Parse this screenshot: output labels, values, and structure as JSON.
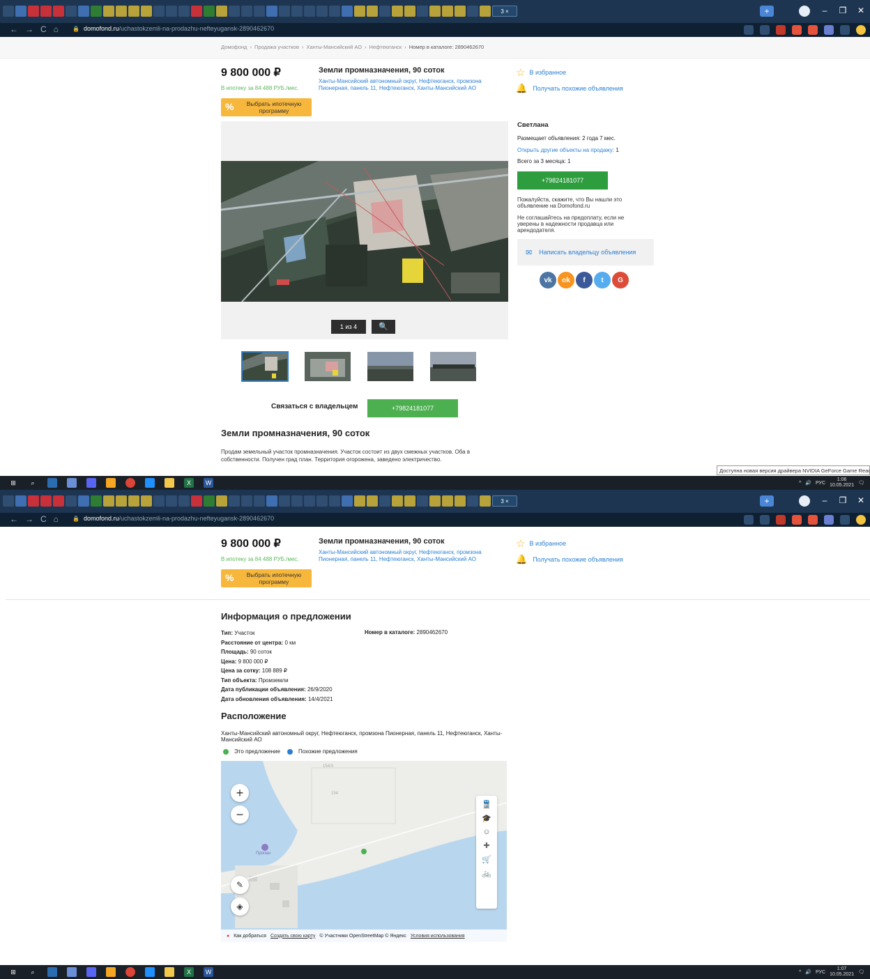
{
  "browser": {
    "url_host": "domofond.ru",
    "url_path": "/uchastokzemli-na-prodazhu-nefteyugansk-2890462670",
    "active_tab_label": "3 ×",
    "window_controls": [
      "–",
      "❐",
      "✕"
    ]
  },
  "breadcrumbs": [
    "Домофонд",
    "Продажа участков",
    "Ханты-Мансийский АО",
    "Нефтеюганск",
    "Номер в каталоге: 2890462670"
  ],
  "listing": {
    "price": "9 800 000 ₽",
    "mortgage_line": "В ипотеку за 84 488 РУБ./мес.",
    "mortgage_button": "Выбрать ипотечную программу",
    "title": "Земли промназначения, 90 соток",
    "address": "Ханты-Мансийский автономный округ, Нефтеюганск, промзона Пионерная, панель 11, Нефтеюганск, Ханты-Мансийский АО",
    "favorite": "В избранное",
    "similar": "Получать похожие объявления"
  },
  "gallery": {
    "counter": "1 из 4",
    "zoom_icon": "zoom-icon"
  },
  "seller": {
    "name": "Светлана",
    "posting_since": "Размещает объявления: 2 года 7 мес.",
    "other_objects": "Открыть другие объекты на продажу:",
    "other_objects_count": "1",
    "total_3_months": "Всего за 3 месяца: 1",
    "phone": "+79824181077",
    "note1": "Пожалуйста, скажите, что Вы нашли это объявление на Domofond.ru",
    "note2": "Не соглашайтесь на предоплату, если не уверены в надежности продавца или арендодателя.",
    "write_owner": "Написать владельцу объявления"
  },
  "socials": [
    {
      "label": "vk",
      "color": "#4c75a3"
    },
    {
      "label": "ok",
      "color": "#f7931e"
    },
    {
      "label": "f",
      "color": "#3b5998"
    },
    {
      "label": "t",
      "color": "#55acee"
    },
    {
      "label": "G",
      "color": "#dd4b39"
    }
  ],
  "contact": {
    "label": "Связаться с владельцем",
    "phone": "+79824181077"
  },
  "description": {
    "title": "Земли промназначения, 90 соток",
    "text": "Продам земельный участок промназначения. Участок состоит из двух смежных участков. Оба в собственности. Получен град план. Территория огорожена, заведено электричество."
  },
  "nvidia_notice": "Доступна новая версия драйвера NVIDIA GeForce Game Ready",
  "taskbar": {
    "lang": "РУС",
    "time1": "1:06",
    "date1": "10.05.2021",
    "time2": "1:07",
    "date2": "10.05.2021"
  },
  "info": {
    "title": "Информация о предложении",
    "catalog_label": "Номер в каталоге:",
    "catalog_value": "2890462670",
    "rows": [
      {
        "label": "Тип:",
        "value": "Участок"
      },
      {
        "label": "Расстояние от центра:",
        "value": "0 км"
      },
      {
        "label": "Площадь:",
        "value": "90 соток"
      },
      {
        "label": "Цена:",
        "value": "9 800 000 ₽"
      },
      {
        "label": "Цена за сотку:",
        "value": "108 889 ₽"
      },
      {
        "label": "Тип объекта:",
        "value": "Промземли"
      },
      {
        "label": "Дата публикации объявления:",
        "value": "26/9/2020"
      },
      {
        "label": "Дата обновления объявления:",
        "value": "14/4/2021"
      }
    ]
  },
  "location": {
    "title": "Расположение",
    "address": "Ханты-Мансийский автономный округ, Нефтеюганск, промзона Пионерная, панель 11, Нефтеюганск, Ханты-Мансийский АО",
    "legend_this": "Это предложение",
    "legend_similar": "Похожие предложения",
    "legend_this_color": "#4caf50",
    "legend_similar_color": "#2a7fd4"
  },
  "map": {
    "zoom_in": "+",
    "zoom_out": "−",
    "poi_label": "Пропан",
    "label_154": "154",
    "label_154a": "154/3",
    "how_to_get": "Как добраться",
    "create_map": "Создать свою карту",
    "attribution": "© Участники OpenStreetMap © Яндекс",
    "terms": "Условия использования"
  }
}
